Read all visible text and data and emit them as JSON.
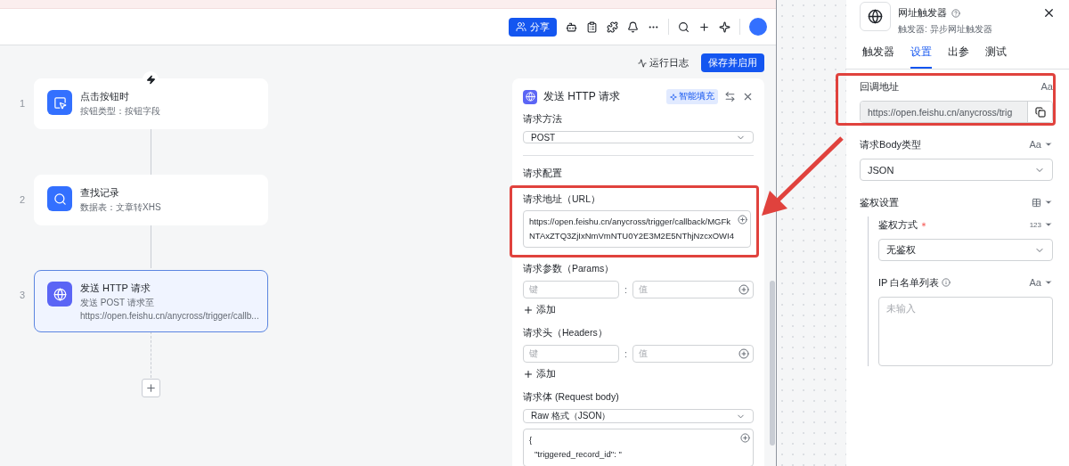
{
  "header": {
    "share_button": "分享"
  },
  "canvas": {
    "run_log": "运行日志",
    "save_button": "保存并启用",
    "nodes": [
      {
        "index": "1",
        "kind": "trigger",
        "title": "点击按钮时",
        "subtitle": "按钮类型：按钮字段",
        "selected": false
      },
      {
        "index": "2",
        "kind": "search",
        "title": "查找记录",
        "subtitle": "数据表：文章转XHS",
        "selected": false
      },
      {
        "index": "3",
        "kind": "http",
        "title": "发送 HTTP 请求",
        "subtitle": "发送 POST 请求至",
        "detail": "https://open.feishu.cn/anycross/trigger/callb...",
        "selected": true
      }
    ]
  },
  "http_panel": {
    "title": "发送 HTTP 请求",
    "ai_fill": "智能填充",
    "method_label": "请求方法",
    "method": "POST",
    "section": "请求配置",
    "url_label": "请求地址（URL）",
    "url": "https://open.feishu.cn/anycross/trigger/callback/MGFkNTAxZTQ3ZjIxNmVmNTU0Y2E3M2E5NThjNzcxOWI4",
    "params": {
      "label": "请求参数（Params）",
      "key_placeholder": "键",
      "separator": ":",
      "value_placeholder": "值",
      "add": "添加"
    },
    "headers": {
      "label": "请求头（Headers）",
      "key_placeholder": "键",
      "separator": ":",
      "value_placeholder": "值",
      "add": "添加"
    },
    "body_label": "请求体 (Request body)",
    "body_format": "Raw 格式（JSON）",
    "body_lines": [
      "{",
      "\"triggered_record_id\": \""
    ]
  },
  "trigger_panel": {
    "title": "网址触发器",
    "subtitle": "触发器: 异步网址触发器",
    "tabs": [
      {
        "label": "触发器",
        "selected": false
      },
      {
        "label": "设置",
        "selected": true
      },
      {
        "label": "出参",
        "selected": false
      },
      {
        "label": "测试",
        "selected": false
      }
    ],
    "fields": [
      {
        "kind": "copy",
        "label": "回调地址",
        "type_label": "Aa",
        "value": "https://open.feishu.cn/anycross/trig"
      },
      {
        "kind": "select",
        "label": "请求Body类型",
        "type_label": "Aa",
        "value": "JSON"
      },
      {
        "kind": "group",
        "label": "鉴权设置",
        "children": [
          {
            "kind": "select",
            "label": "鉴权方式",
            "required": true,
            "type_label": "123",
            "value": "无鉴权"
          },
          {
            "kind": "textarea",
            "label": "IP 白名单列表",
            "info": true,
            "type_label": "Aa",
            "placeholder": "未输入"
          }
        ]
      }
    ]
  }
}
